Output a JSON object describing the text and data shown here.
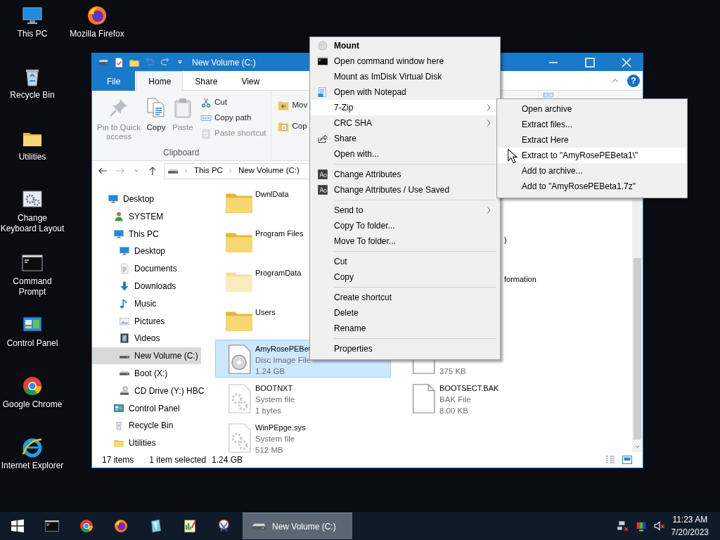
{
  "desktop_icons": [
    {
      "label": "This PC"
    },
    {
      "label": "Mozilla Firefox"
    },
    {
      "label": "Recycle Bin"
    },
    {
      "label": "Utilities"
    },
    {
      "label": "Change Keyboard Layout"
    },
    {
      "label": "Command Prompt"
    },
    {
      "label": "Control Panel"
    },
    {
      "label": "Google Chrome"
    },
    {
      "label": "Internet Explorer"
    }
  ],
  "explorer": {
    "title": "New Volume (C:)",
    "help": "?",
    "ribbon_tabs": [
      {
        "label": "File",
        "kind": "file",
        "selected": false
      },
      {
        "label": "Home",
        "kind": "tab",
        "selected": true
      },
      {
        "label": "Share",
        "kind": "tab",
        "selected": false
      },
      {
        "label": "View",
        "kind": "tab",
        "selected": false
      }
    ],
    "clipboard_group": {
      "label": "Clipboard",
      "large_buttons": [
        {
          "label": "Pin to Quick access",
          "disabled": true
        },
        {
          "label": "Copy",
          "disabled": false
        },
        {
          "label": "Paste",
          "disabled": true
        }
      ],
      "small_buttons": [
        {
          "label": "Cut",
          "disabled": false
        },
        {
          "label": "Copy path",
          "disabled": false
        },
        {
          "label": "Paste shortcut",
          "disabled": true
        }
      ]
    },
    "organize_group": {
      "buttons": [
        {
          "label": "Mov"
        },
        {
          "label": "Cop"
        }
      ]
    },
    "address": {
      "crumbs": [
        "This PC",
        "New Volume (C:)"
      ]
    },
    "nav_tree": [
      {
        "label": "Desktop",
        "selected": false,
        "children": [
          {
            "label": "SYSTEM",
            "selected": false
          },
          {
            "label": "This PC",
            "selected": false,
            "children": [
              {
                "label": "Desktop",
                "selected": false
              },
              {
                "label": "Documents",
                "selected": false
              },
              {
                "label": "Downloads",
                "selected": false
              },
              {
                "label": "Music",
                "selected": false
              },
              {
                "label": "Pictures",
                "selected": false
              },
              {
                "label": "Videos",
                "selected": false
              },
              {
                "label": "New Volume (C:)",
                "selected": true
              },
              {
                "label": "Boot (X:)",
                "selected": false
              },
              {
                "label": "CD Drive (Y:) HBC",
                "selected": false
              }
            ]
          },
          {
            "label": "Control Panel",
            "selected": false
          },
          {
            "label": "Recycle Bin",
            "selected": false
          },
          {
            "label": "Utilities",
            "selected": false
          }
        ]
      }
    ],
    "file_rows": [
      {
        "left": {
          "kind": "folder",
          "name": "DwnlData",
          "hidden": false,
          "selected": false
        }
      },
      {
        "left": {
          "kind": "folder",
          "name": "Program Files",
          "hidden": false,
          "selected": false
        },
        "right": {
          "kind": "partial-name",
          "name": ")",
          "selected": false
        }
      },
      {
        "left": {
          "kind": "folder",
          "name": "ProgramData",
          "hidden": true,
          "selected": false
        },
        "right": {
          "kind": "partial-name",
          "name": "formation",
          "selected": false
        }
      },
      {
        "left": {
          "kind": "folder",
          "name": "Users",
          "hidden": false,
          "selected": false
        }
      },
      {
        "left": {
          "kind": "disc",
          "name": "AmyRosePEBet",
          "type": "Disc Image File",
          "size": "1.24 GB",
          "hidden": false,
          "selected": true
        },
        "right": {
          "kind": "partial-size",
          "size": "375 KB",
          "selected": false
        }
      },
      {
        "left": {
          "kind": "system",
          "name": "BOOTNXT",
          "type": "System file",
          "size": "1 bytes",
          "hidden": true,
          "selected": false
        },
        "right": {
          "kind": "file",
          "name": "BOOTSECT.BAK",
          "type": "BAK File",
          "size": "8.00 KB",
          "selected": false
        }
      },
      {
        "left": {
          "kind": "system",
          "name": "WinPEpge.sys",
          "type": "System file",
          "size": "512 MB",
          "hidden": true,
          "selected": false
        }
      }
    ],
    "status_bar": {
      "item_count": "17 items",
      "selection": "1 item selected",
      "selection_size": "1.24 GB"
    }
  },
  "context_menu": {
    "items": [
      {
        "kind": "default",
        "label": "Mount",
        "selected": false
      },
      {
        "kind": "item",
        "label": "Open command window here",
        "selected": false
      },
      {
        "kind": "item",
        "label": "Mount as ImDisk Virtual Disk",
        "selected": false
      },
      {
        "kind": "item",
        "label": "Open with Notepad",
        "selected": false
      },
      {
        "kind": "submenu",
        "label": "7-Zip",
        "selected": true
      },
      {
        "kind": "submenu",
        "label": "CRC SHA",
        "selected": false
      },
      {
        "kind": "item",
        "label": "Share",
        "selected": false
      },
      {
        "kind": "item",
        "label": "Open with...",
        "selected": false
      },
      {
        "kind": "separator"
      },
      {
        "kind": "item",
        "label": "Change Attributes",
        "selected": false
      },
      {
        "kind": "item",
        "label": "Change Attributes / Use Saved",
        "selected": false
      },
      {
        "kind": "separator"
      },
      {
        "kind": "submenu",
        "label": "Send to",
        "selected": false
      },
      {
        "kind": "item",
        "label": "Copy To folder...",
        "selected": false
      },
      {
        "kind": "item",
        "label": "Move To folder...",
        "selected": false
      },
      {
        "kind": "separator"
      },
      {
        "kind": "item",
        "label": "Cut",
        "selected": false
      },
      {
        "kind": "item",
        "label": "Copy",
        "selected": false
      },
      {
        "kind": "separator"
      },
      {
        "kind": "item",
        "label": "Create shortcut",
        "selected": false
      },
      {
        "kind": "item",
        "label": "Delete",
        "selected": false
      },
      {
        "kind": "item",
        "label": "Rename",
        "selected": false
      },
      {
        "kind": "separator"
      },
      {
        "kind": "item",
        "label": "Properties",
        "selected": false
      }
    ]
  },
  "zip_submenu": {
    "items": [
      {
        "label": "Open archive",
        "selected": false
      },
      {
        "label": "Extract files...",
        "selected": false
      },
      {
        "label": "Extract Here",
        "selected": false
      },
      {
        "label": "Extract to \"AmyRosePEBeta1\\\"",
        "selected": true
      },
      {
        "label": "Add to archive...",
        "selected": false
      },
      {
        "label": "Add to \"AmyRosePEBeta1.7z\"",
        "selected": false
      }
    ]
  },
  "taskbar": {
    "window_button": {
      "label": "New Volume (C:)",
      "selected": true
    },
    "time": "11:23 AM",
    "date": "7/20/2023"
  }
}
